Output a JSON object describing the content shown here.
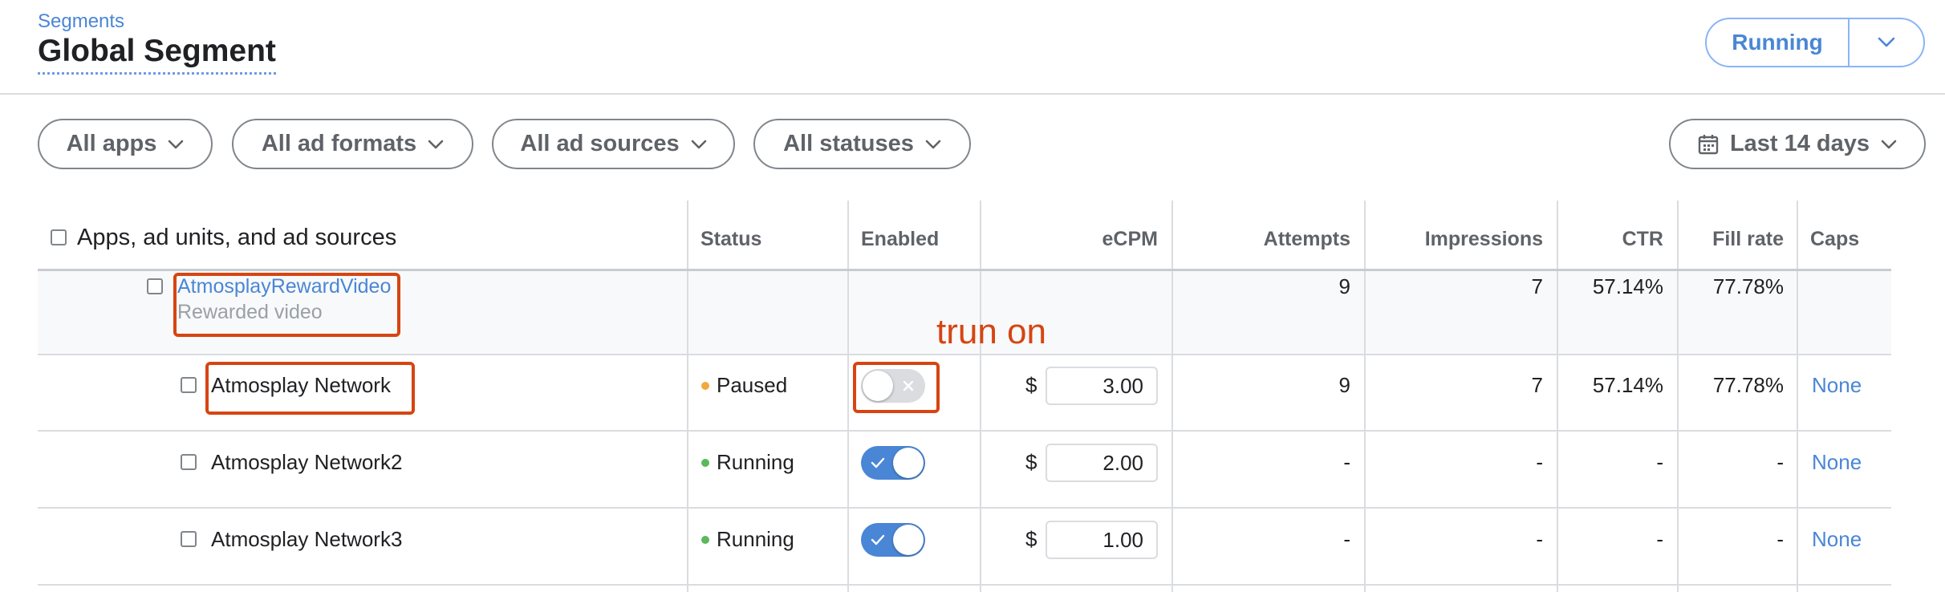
{
  "header": {
    "breadcrumb": "Segments",
    "title": "Global Segment",
    "status_button": "Running"
  },
  "filters": {
    "apps": "All apps",
    "ad_formats": "All ad formats",
    "ad_sources": "All ad sources",
    "statuses": "All statuses",
    "date_range": "Last 14 days"
  },
  "table": {
    "columns": {
      "name": "Apps, ad units, and ad sources",
      "status": "Status",
      "enabled": "Enabled",
      "ecpm": "eCPM",
      "attempts": "Attempts",
      "impressions": "Impressions",
      "ctr": "CTR",
      "fill_rate": "Fill rate",
      "caps": "Caps"
    },
    "parent_row": {
      "name": "AtmosplayRewardVideo",
      "format": "Rewarded video",
      "attempts": "9",
      "impressions": "7",
      "ctr": "57.14%",
      "fill_rate": "77.78%"
    },
    "rows": [
      {
        "name": "Atmosplay Network",
        "status": "Paused",
        "status_color": "#f2a93b",
        "enabled": false,
        "currency": "$",
        "ecpm": "3.00",
        "attempts": "9",
        "impressions": "7",
        "ctr": "57.14%",
        "fill_rate": "77.78%",
        "caps": "None"
      },
      {
        "name": "Atmosplay Network2",
        "status": "Running",
        "status_color": "#5cb85c",
        "enabled": true,
        "currency": "$",
        "ecpm": "2.00",
        "attempts": "-",
        "impressions": "-",
        "ctr": "-",
        "fill_rate": "-",
        "caps": "None"
      },
      {
        "name": "Atmosplay Network3",
        "status": "Running",
        "status_color": "#5cb85c",
        "enabled": true,
        "currency": "$",
        "ecpm": "1.00",
        "attempts": "-",
        "impressions": "-",
        "ctr": "-",
        "fill_rate": "-",
        "caps": "None"
      }
    ]
  },
  "annotation": {
    "text": "trun on",
    "color": "#d64512"
  },
  "colors": {
    "accent": "#4a86d6",
    "paused": "#f2a93b",
    "running": "#5cb85c"
  }
}
